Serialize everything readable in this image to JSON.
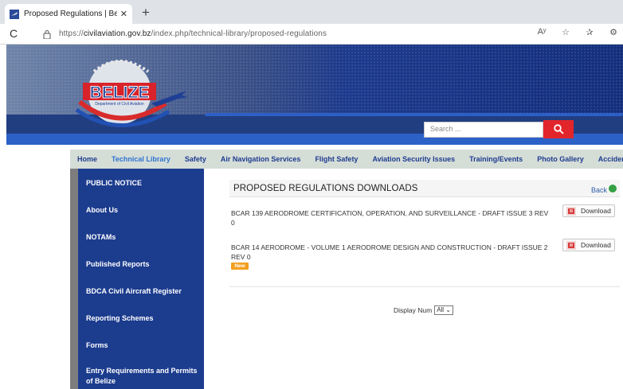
{
  "browser": {
    "tab_title": "Proposed Regulations | Belize De",
    "tab_close": "✕",
    "new_tab": "+",
    "url_prefix": "https://",
    "url_host": "civilaviation.gov.bz",
    "url_path": "/index.php/technical-library/proposed-regulations",
    "reload_icon": "C",
    "read_aloud_icon": "Aʸ",
    "favorites_icon": "☆",
    "collections_icon": "✰",
    "browser_menu_icon": "⚙"
  },
  "site": {
    "logo_text": "BELIZE",
    "logo_subtext": "Department of Civil Aviation",
    "search_placeholder": "Search ..."
  },
  "nav": {
    "items": [
      {
        "label": "Home"
      },
      {
        "label": "Technical Library"
      },
      {
        "label": "Safety"
      },
      {
        "label": "Air Navigation Services"
      },
      {
        "label": "Flight Safety"
      },
      {
        "label": "Aviation Security Issues"
      },
      {
        "label": "Training/Events"
      },
      {
        "label": "Photo Gallery"
      },
      {
        "label": "Accident Incident Investi"
      }
    ]
  },
  "sidebar": {
    "items": [
      {
        "label": "PUBLIC NOTICE"
      },
      {
        "label": "About Us"
      },
      {
        "label": "NOTAMs"
      },
      {
        "label": "Published Reports"
      },
      {
        "label": "BDCA Civil Aircraft Register"
      },
      {
        "label": "Reporting Schemes"
      },
      {
        "label": "Forms"
      },
      {
        "label": "Entry Requirements and Permits of Belize"
      }
    ]
  },
  "content": {
    "section_title": "PROPOSED REGULATIONS DOWNLOADS",
    "back_label": "Back",
    "docs": [
      {
        "title": "BCAR 139 AERODROME CERTIFICATION, OPERATION, AND SURVEILLANCE - DRAFT ISSUE 3 REV 0",
        "button": "Download"
      },
      {
        "title": "BCAR 14 AERODROME - VOLUME 1 AERODROME DESIGN AND CONSTRUCTION - DRAFT ISSUE 2 REV 0",
        "button": "Download",
        "badge": "New"
      }
    ],
    "display_num_label": "Display Num",
    "display_num_value": "All"
  }
}
